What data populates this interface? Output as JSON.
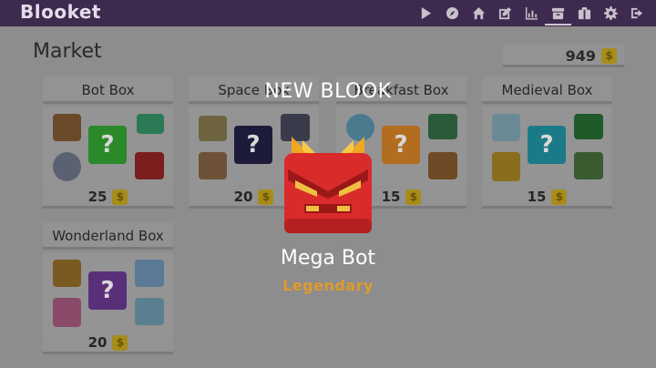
{
  "app": {
    "logo": "Blooket"
  },
  "nav": [
    {
      "name": "play-icon"
    },
    {
      "name": "discover-icon"
    },
    {
      "name": "home-icon"
    },
    {
      "name": "edit-icon"
    },
    {
      "name": "stats-icon"
    },
    {
      "name": "market-icon",
      "active": true
    },
    {
      "name": "blooks-icon"
    },
    {
      "name": "settings-icon"
    },
    {
      "name": "logout-icon"
    }
  ],
  "market": {
    "title": "Market",
    "tokens": "949",
    "coin_symbol": "$"
  },
  "boxes": [
    {
      "name": "Bot Box",
      "price": "25",
      "mystery_color": "#2a8a2a"
    },
    {
      "name": "Space Box",
      "price": "20",
      "mystery_color": "#1c1b3a"
    },
    {
      "name": "Breakfast Box",
      "price": "15",
      "mystery_color": "#b26d20"
    },
    {
      "name": "Medieval Box",
      "price": "15",
      "mystery_color": "#1b7a88"
    },
    {
      "name": "Wonderland Box",
      "price": "20",
      "mystery_color": "#5a2f7a"
    }
  ],
  "overlay": {
    "heading": "NEW BLOOK",
    "blook_name": "Mega Bot",
    "rarity": "Legendary",
    "rarity_color": "#e09a2a"
  }
}
